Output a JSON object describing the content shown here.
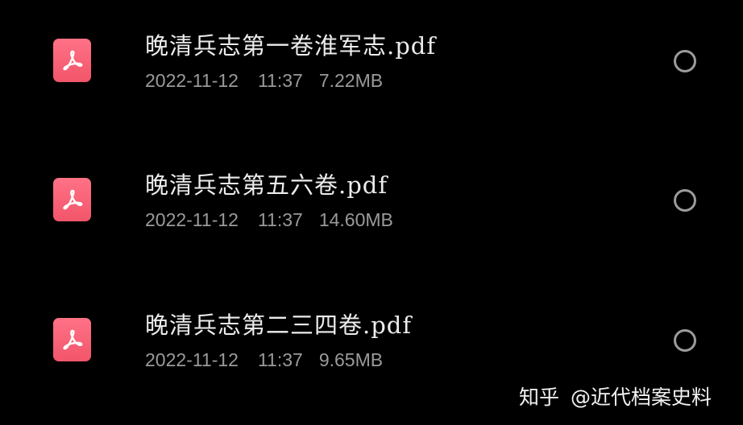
{
  "files": [
    {
      "name": "晚清兵志第一卷淮军志.pdf",
      "date": "2022-11-12",
      "time": "11:37",
      "size": "7.22MB",
      "icon": "pdf-icon"
    },
    {
      "name": "晚清兵志第五六卷.pdf",
      "date": "2022-11-12",
      "time": "11:37",
      "size": "14.60MB",
      "icon": "pdf-icon"
    },
    {
      "name": "晚清兵志第二三四卷.pdf",
      "date": "2022-11-12",
      "time": "11:37",
      "size": "9.65MB",
      "icon": "pdf-icon"
    }
  ],
  "watermark": {
    "site": "知乎",
    "handle": "@近代档案史料"
  },
  "colors": {
    "background": "#000000",
    "pdf_icon": "#f65d72",
    "filename_text": "#ececec",
    "meta_text": "#9a9a9a",
    "radio_border": "#9c9c9c"
  }
}
